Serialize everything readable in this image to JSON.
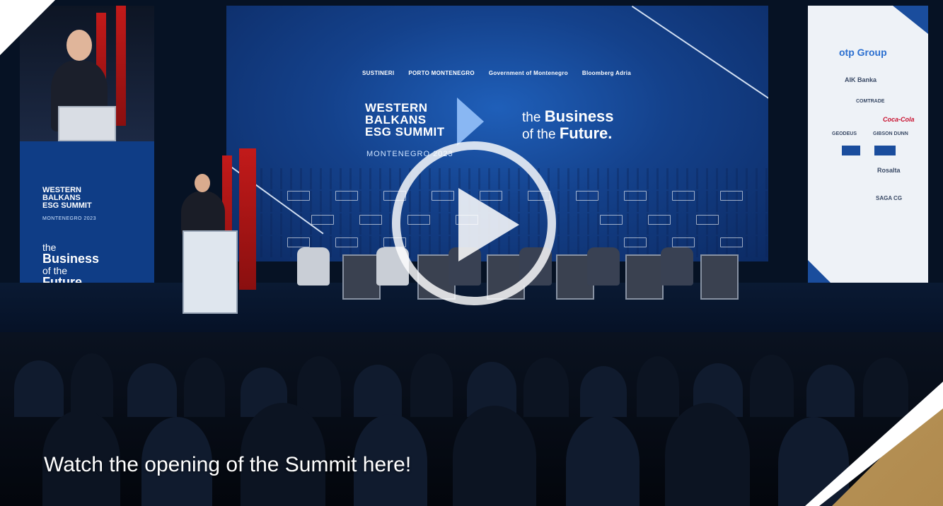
{
  "video": {
    "caption": "Watch the opening of the Summit here!",
    "play_icon": "play-icon",
    "accent_gold": "#c2a064",
    "screen_blue": "#14418b"
  },
  "stage": {
    "main_screen": {
      "sponsors": [
        "SUSTINERI",
        "PORTO MONTENEGRO",
        "Government of Montenegro",
        "Bloomberg Adria"
      ],
      "summit_title_line1": "WESTERN",
      "summit_title_line2": "BALKANS",
      "summit_title_line3": "ESG SUMMIT",
      "summit_subtitle": "MONTENEGRO 2023",
      "tagline_the": "the",
      "tagline_business": "Business",
      "tagline_of_the": "of the",
      "tagline_future": "Future."
    },
    "left_screen": {
      "title_line1": "WESTERN",
      "title_line2": "BALKANS",
      "title_line3": "ESG SUMMIT",
      "subtitle": "MONTENEGRO 2023",
      "tag_the": "the",
      "tag_business": "Business",
      "tag_of_the": "of the",
      "tag_future": "Future."
    },
    "right_screen": {
      "logos": [
        "otp Group",
        "AIK Banka",
        "COMTRADE",
        "Coca-Cola",
        "GEODEUS",
        "GIBSON DUNN",
        "Rosalta",
        "SAGA CG"
      ]
    }
  }
}
